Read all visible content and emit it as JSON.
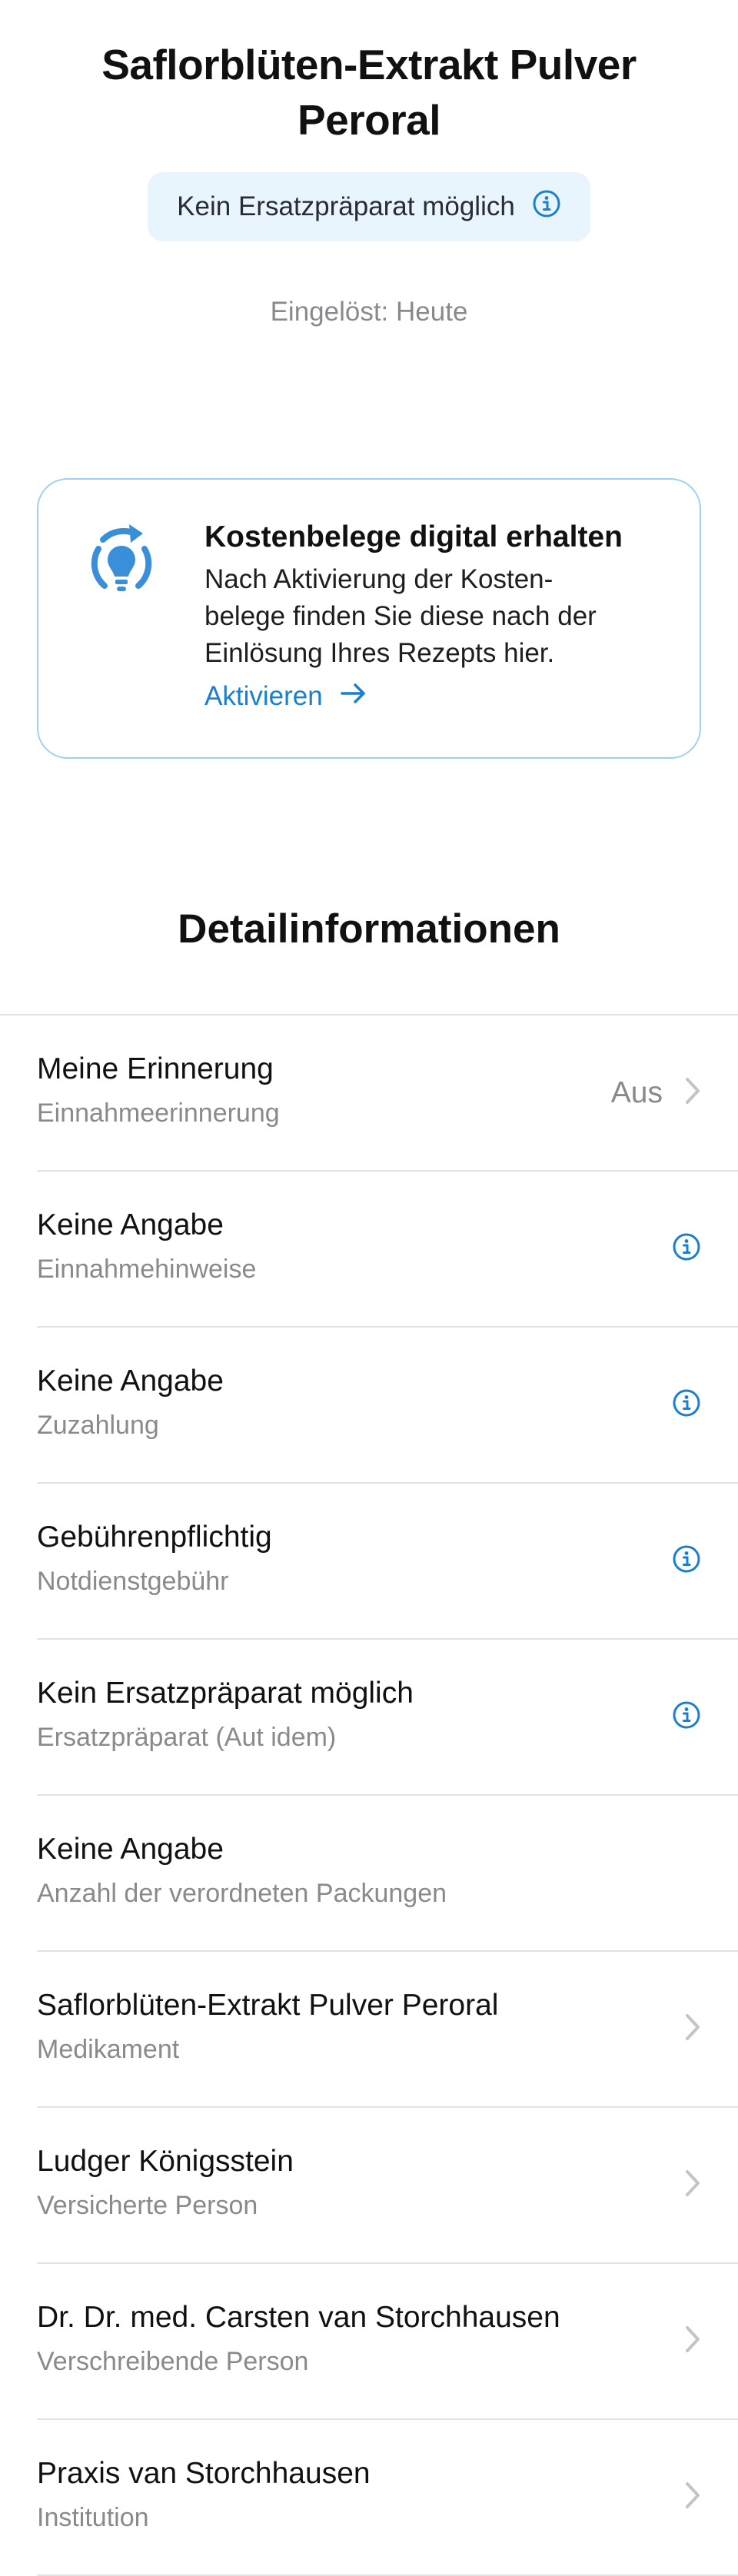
{
  "header": {
    "title": "Saflorblüten-Extrakt Pulver Peroral",
    "badge_label": "Kein Ersatzpräparat möglich",
    "redeemed": "Eingelöst: Heute"
  },
  "receipt_card": {
    "title": "Kostenbelege digital erhalten",
    "text": "Nach Aktivierung der Kosten-\nbelege finden Sie diese nach der\nEinlösung Ihres Rezepts hier.",
    "action_label": "Aktivieren"
  },
  "details": {
    "section_title": "Detailinformationen",
    "rows": [
      {
        "title": "Meine Erinnerung",
        "subtitle": "Einnahmeerinnerung",
        "value": "Aus",
        "accessory": "chevron"
      },
      {
        "title": "Keine Angabe",
        "subtitle": "Einnahmehinweise",
        "value": "",
        "accessory": "info"
      },
      {
        "title": "Keine Angabe",
        "subtitle": "Zuzahlung",
        "value": "",
        "accessory": "info"
      },
      {
        "title": "Gebührenpflichtig",
        "subtitle": "Notdienstgebühr",
        "value": "",
        "accessory": "info"
      },
      {
        "title": "Kein Ersatzpräparat möglich",
        "subtitle": "Ersatzpräparat (Aut idem)",
        "value": "",
        "accessory": "info"
      },
      {
        "title": "Keine Angabe",
        "subtitle": "Anzahl der verordneten Packungen",
        "value": "",
        "accessory": "none"
      },
      {
        "title": "Saflorblüten-Extrakt Pulver Peroral",
        "subtitle": "Medikament",
        "value": "",
        "accessory": "chevron"
      },
      {
        "title": "Ludger Königsstein",
        "subtitle": "Versicherte Person",
        "value": "",
        "accessory": "chevron"
      },
      {
        "title": "Dr. Dr. med. Carsten van Storchhausen",
        "subtitle": "Verschreibende Person",
        "value": "",
        "accessory": "chevron"
      },
      {
        "title": "Praxis van Storchhausen",
        "subtitle": "Institution",
        "value": "",
        "accessory": "chevron"
      }
    ]
  },
  "colors": {
    "accent": "#1b7fd0",
    "badge_bg": "#e9f5fd",
    "card_border": "#9fd0f2",
    "secondary_text": "#8a8a8e",
    "chevron": "#c4c4c8"
  },
  "icons": {
    "info": "info-circle-icon",
    "chevron": "chevron-right-icon",
    "card": "lightbulb-refresh-icon",
    "arrow": "arrow-right-icon"
  }
}
